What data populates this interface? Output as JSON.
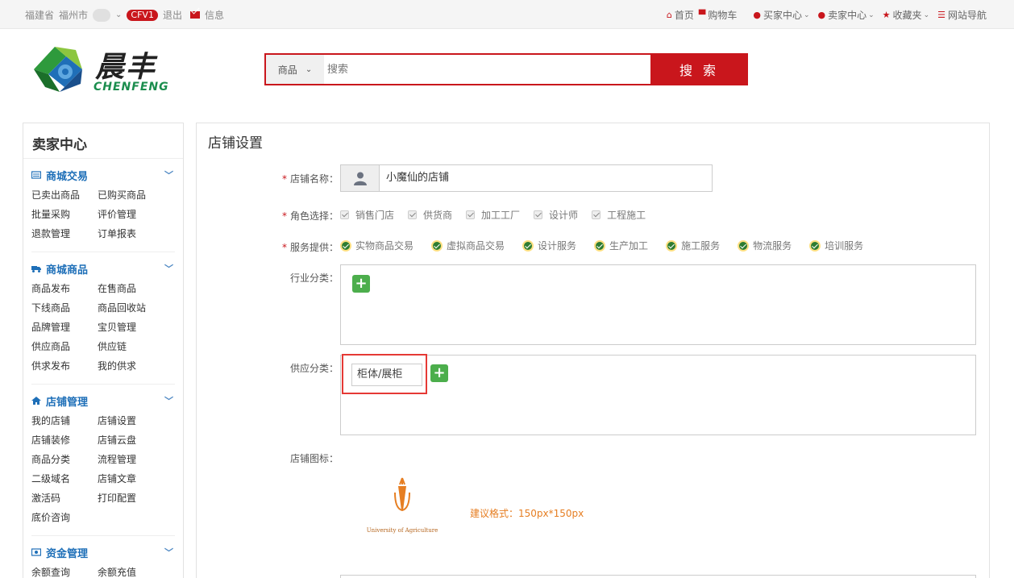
{
  "topbar": {
    "location_province": "福建省",
    "location_city": "福州市",
    "badge": "CFV1",
    "logout": "退出",
    "message": "信息",
    "nav": [
      {
        "label": "首页",
        "icon": "home-icon",
        "dropdown": false
      },
      {
        "label": "购物车",
        "icon": "cart-icon",
        "dropdown": false
      },
      {
        "label": "买家中心",
        "icon": "user-icon",
        "dropdown": true
      },
      {
        "label": "卖家中心",
        "icon": "user-icon",
        "dropdown": true
      },
      {
        "label": "收藏夹",
        "icon": "star-icon",
        "dropdown": true
      },
      {
        "label": "网站导航",
        "icon": "list-icon",
        "dropdown": false
      }
    ]
  },
  "brand": {
    "name_cn": "晨丰",
    "name_en": "CHENFENG"
  },
  "search": {
    "category": "商品",
    "placeholder": "搜索",
    "button": "搜 索"
  },
  "sidebar": {
    "title": "卖家中心",
    "groups": [
      {
        "title": "商城交易",
        "icon": "card-icon",
        "items": [
          "已卖出商品",
          "已购买商品",
          "批量采购",
          "评价管理",
          "退款管理",
          "订单报表"
        ]
      },
      {
        "title": "商城商品",
        "icon": "truck-icon",
        "items": [
          "商品发布",
          "在售商品",
          "下线商品",
          "商品回收站",
          "品牌管理",
          "宝贝管理",
          "供应商品",
          "供应链",
          "供求发布",
          "我的供求"
        ]
      },
      {
        "title": "店铺管理",
        "icon": "home-icon",
        "items": [
          "我的店铺",
          "店铺设置",
          "店铺装修",
          "店铺云盘",
          "商品分类",
          "流程管理",
          "二级域名",
          "店铺文章",
          "激活码",
          "打印配置",
          "底价咨询"
        ]
      },
      {
        "title": "资金管理",
        "icon": "money-icon",
        "items": [
          "余额查询",
          "余额充值"
        ]
      }
    ]
  },
  "main": {
    "title": "店铺设置",
    "shop_name_label": "店铺名称：",
    "shop_name_value": "小魔仙的店铺",
    "role_label": "角色选择：",
    "roles": [
      "销售门店",
      "供货商",
      "加工工厂",
      "设计师",
      "工程施工"
    ],
    "service_label": "服务提供：",
    "services": [
      "实物商品交易",
      "虚拟商品交易",
      "设计服务",
      "生产加工",
      "施工服务",
      "物流服务",
      "培训服务"
    ],
    "industry_label": "行业分类：",
    "supply_label": "供应分类：",
    "supply_tag": "柜体/展柜",
    "shop_logo_label": "店铺图标：",
    "shop_logo_caption": "University of Agriculture",
    "logo_hint": "建议格式：150px*150px",
    "colors": {
      "accent": "#c9161c",
      "link": "#1e6fb8",
      "add": "#4cae4c",
      "hint": "#e67e22"
    }
  }
}
